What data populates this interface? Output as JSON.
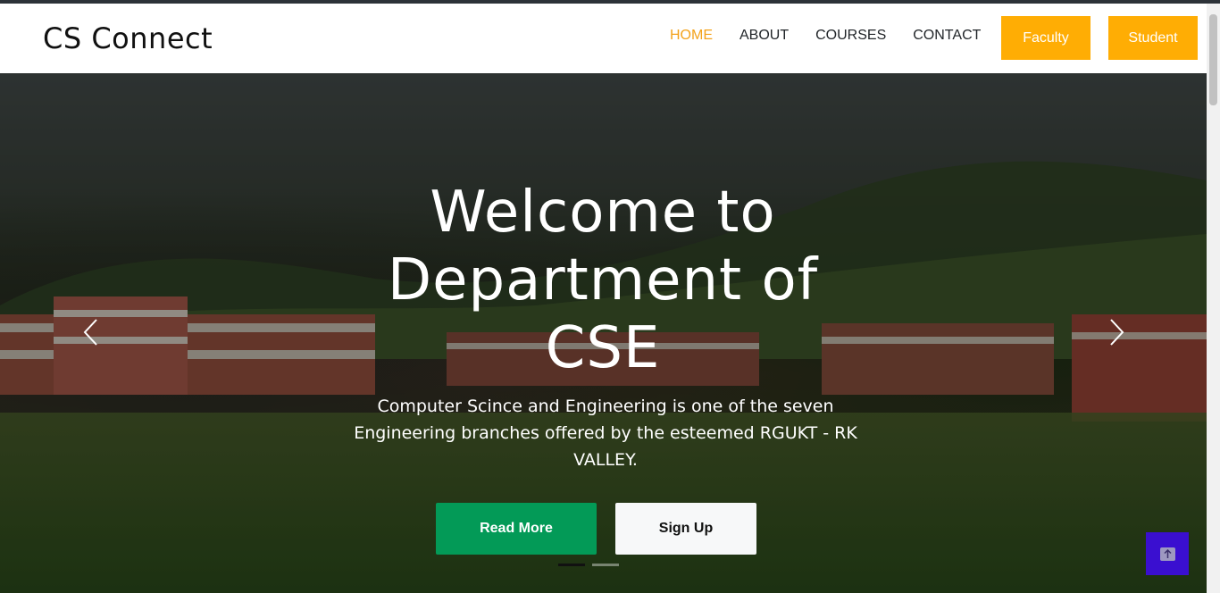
{
  "navbar": {
    "brand": "CS Connect",
    "links": [
      {
        "label": "HOME",
        "active": true
      },
      {
        "label": "ABOUT",
        "active": false
      },
      {
        "label": "COURSES",
        "active": false
      },
      {
        "label": "CONTACT",
        "active": false
      }
    ],
    "faculty_label": "Faculty",
    "student_label": "Student"
  },
  "hero": {
    "title_line1": "Welcome to",
    "title_line2": "Department of",
    "title_line3": "CSE",
    "subtitle": "Computer Scince and Engineering is one of the seven Engineering branches offered by the esteemed RGUKT - RK VALLEY.",
    "read_more_label": "Read More",
    "signup_label": "Sign Up",
    "prev_icon": "chevron-left-icon",
    "next_icon": "chevron-right-icon",
    "slides": 2,
    "active_slide": 1
  },
  "scroll_top": {
    "icon": "arrow-up-icon"
  },
  "colors": {
    "accent_yellow": "#ffad04",
    "active_link": "#f3a21a",
    "green_button": "#039a57",
    "scroll_button": "#3a0fd0"
  }
}
